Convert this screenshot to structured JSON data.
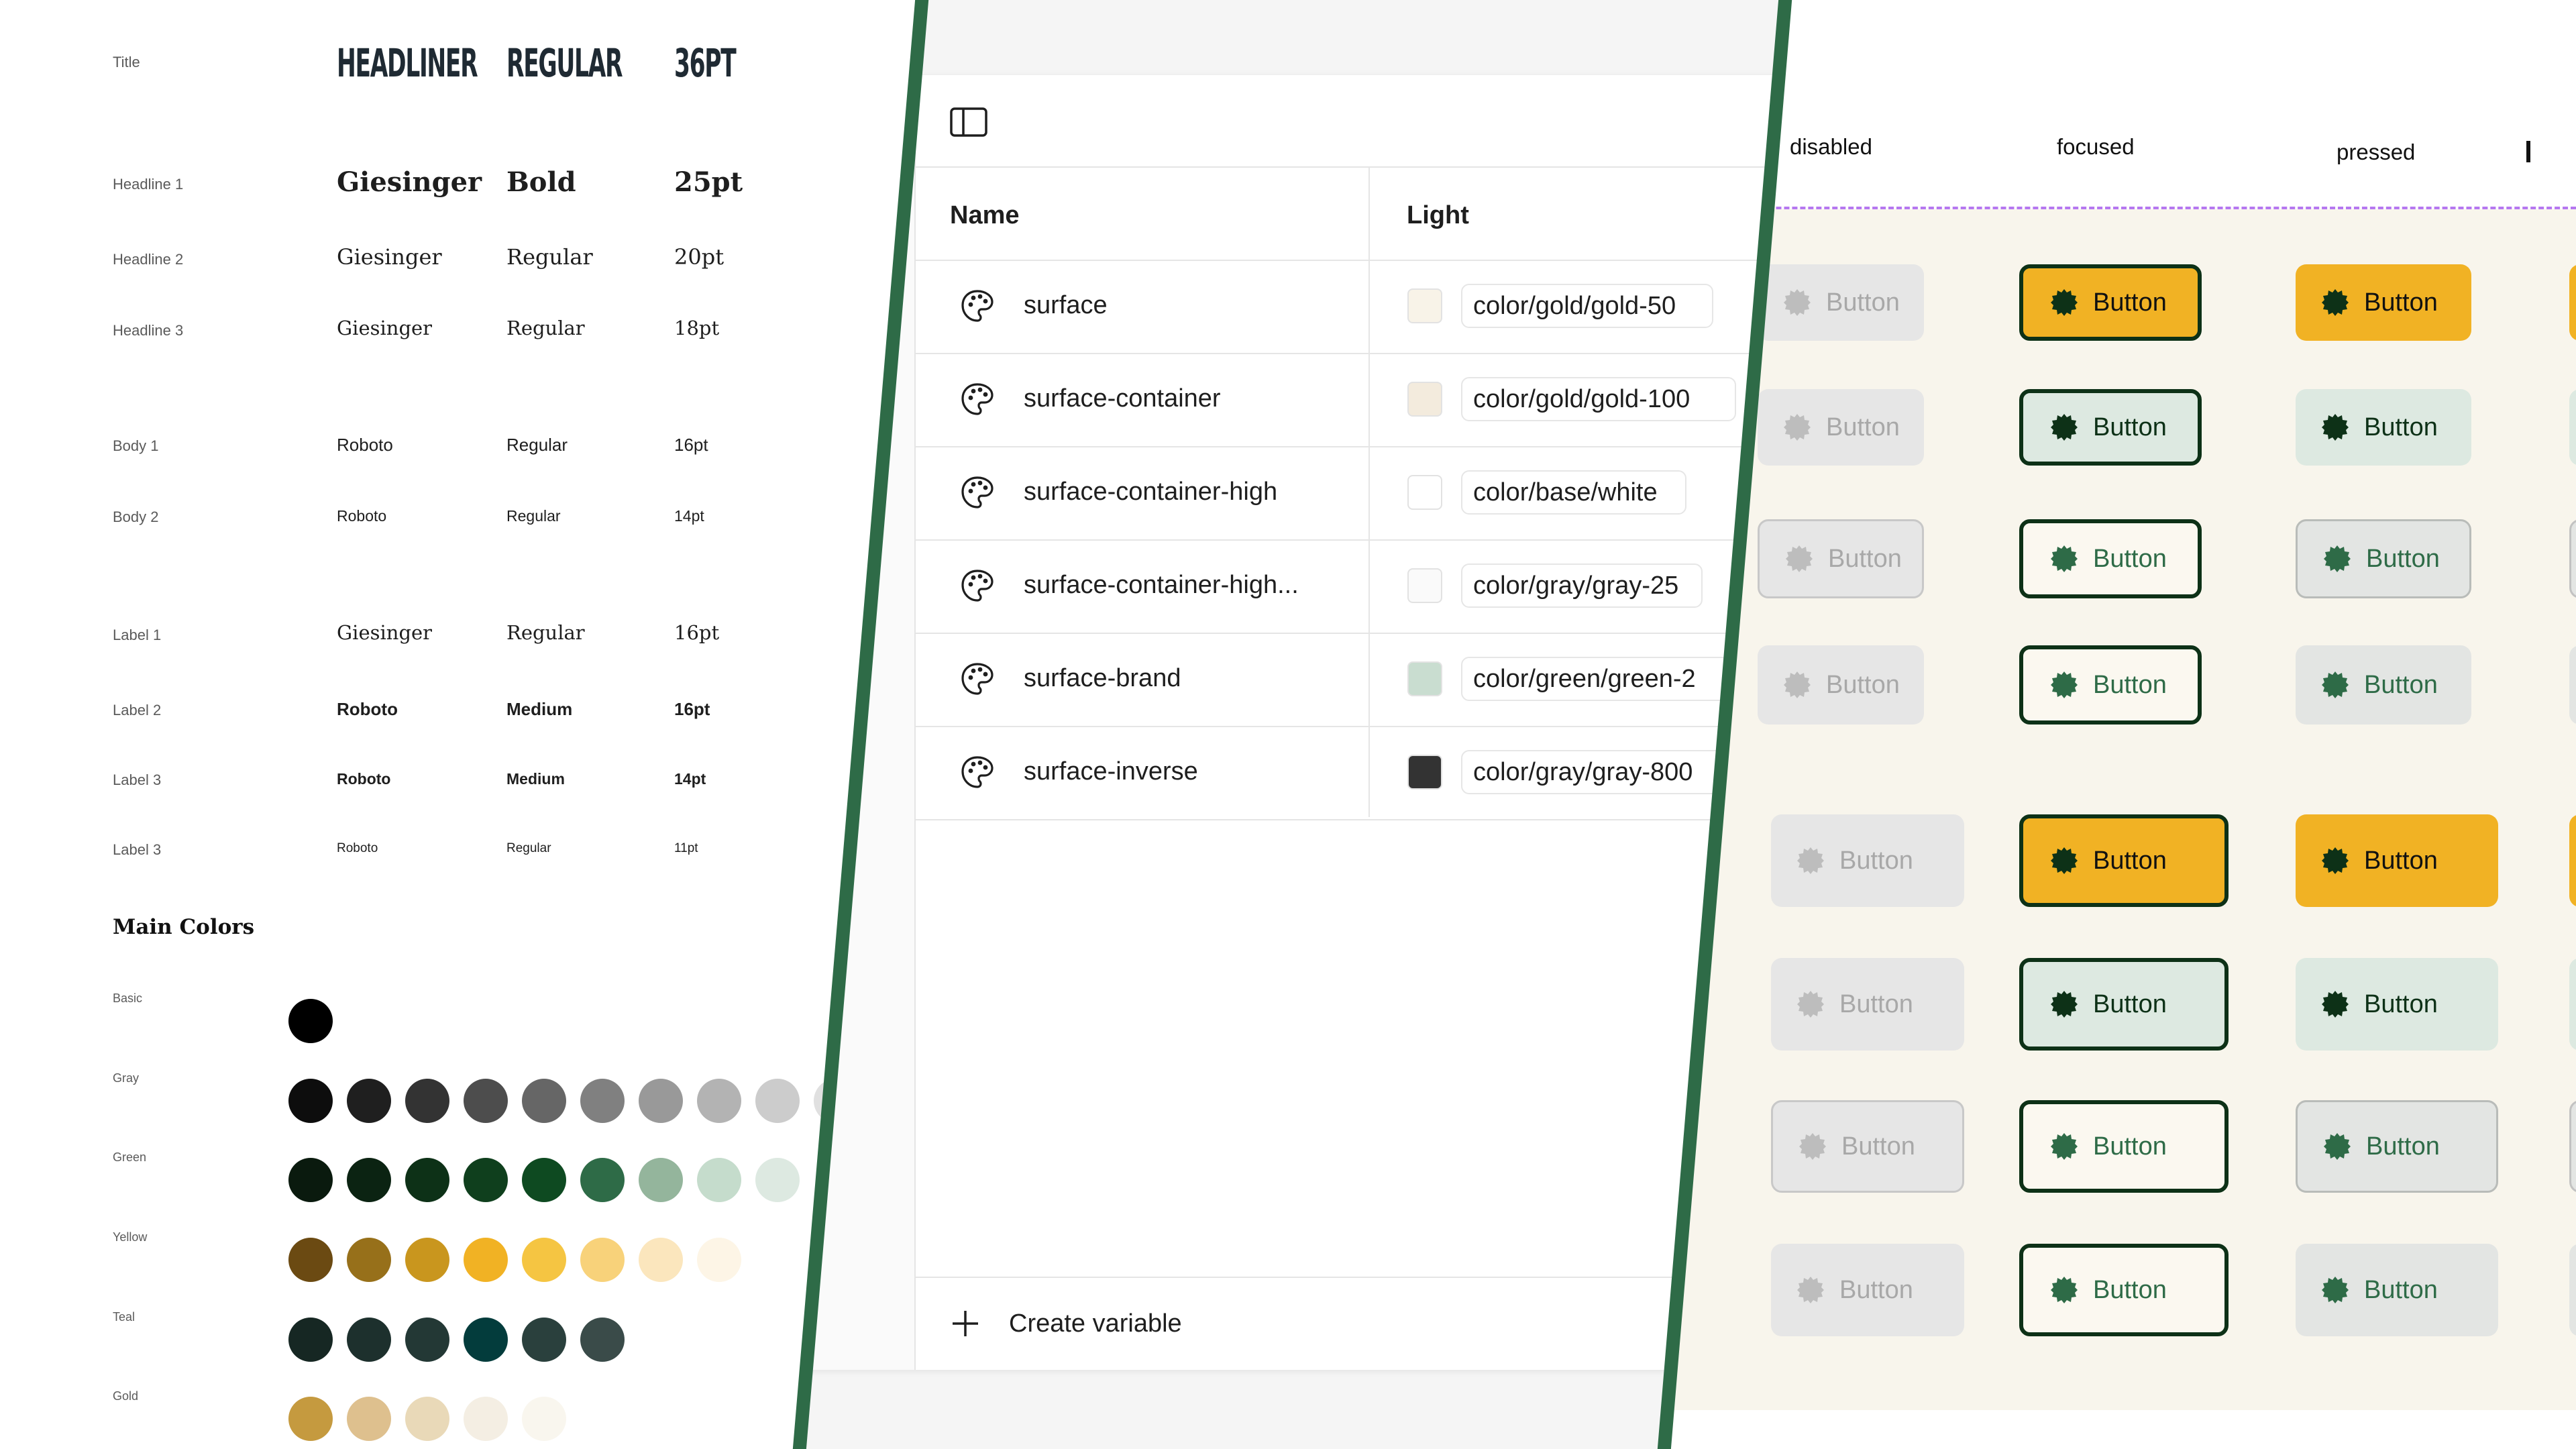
{
  "typography": {
    "rows": [
      {
        "label": "Title",
        "font": "HEADLINER",
        "weight": "REGULAR",
        "size": "36PT"
      },
      {
        "label": "Headline 1",
        "font": "Giesinger",
        "weight": "Bold",
        "size": "25pt"
      },
      {
        "label": "Headline 2",
        "font": "Giesinger",
        "weight": "Regular",
        "size": "20pt"
      },
      {
        "label": "Headline 3",
        "font": "Giesinger",
        "weight": "Regular",
        "size": "18pt"
      },
      {
        "label": "Body 1",
        "font": "Roboto",
        "weight": "Regular",
        "size": "16pt"
      },
      {
        "label": "Body 2",
        "font": "Roboto",
        "weight": "Regular",
        "size": "14pt"
      },
      {
        "label": "Label 1",
        "font": "Giesinger",
        "weight": "Regular",
        "size": "16pt"
      },
      {
        "label": "Label 2",
        "font": "Roboto",
        "weight": "Medium",
        "size": "16pt"
      },
      {
        "label": "Label 3",
        "font": "Roboto",
        "weight": "Medium",
        "size": "14pt"
      },
      {
        "label": "Label 3",
        "font": "Roboto",
        "weight": "Regular",
        "size": "11pt"
      }
    ]
  },
  "main_colors": {
    "heading": "Main Colors",
    "groups": [
      {
        "name": "Basic",
        "colors": [
          "#000000"
        ]
      },
      {
        "name": "Gray",
        "colors": [
          "#0d0d0d",
          "#1f1f1f",
          "#333333",
          "#4d4d4d",
          "#666666",
          "#808080",
          "#999999",
          "#b3b3b3",
          "#cccccc",
          "#e0e0e0"
        ]
      },
      {
        "name": "Green",
        "colors": [
          "#0a1a0e",
          "#0b2312",
          "#0d3117",
          "#0f3f1d",
          "#0e4a21",
          "#2e6b47",
          "#94b59c",
          "#c5dccc",
          "#dde9e1"
        ]
      },
      {
        "name": "Yellow",
        "colors": [
          "#6b4a12",
          "#97701a",
          "#c9961e",
          "#f1b224",
          "#f5c542",
          "#f8d27a",
          "#fbe6bd",
          "#fdf5e6"
        ]
      },
      {
        "name": "Teal",
        "colors": [
          "#162723",
          "#1d302d",
          "#233835",
          "#033c3c",
          "#2a403d",
          "#3a4b49"
        ]
      },
      {
        "name": "Gold",
        "colors": [
          "#c59a3f",
          "#dec08e",
          "#e9d9b8",
          "#f4eee3",
          "#f9f6ee"
        ]
      }
    ]
  },
  "variables": {
    "headers": {
      "name": "Name",
      "light": "Light"
    },
    "rows": [
      {
        "name": "surface",
        "value": "color/gold/gold-50",
        "swatch": "#f8f3e8"
      },
      {
        "name": "surface-container",
        "value": "color/gold/gold-100",
        "swatch": "#f3ebdd"
      },
      {
        "name": "surface-container-high",
        "value": "color/base/white",
        "swatch": "#ffffff"
      },
      {
        "name": "surface-container-high...",
        "value": "color/gray/gray-25",
        "swatch": "#fafafa"
      },
      {
        "name": "surface-brand",
        "value": "color/green/green-2",
        "swatch": "#c9ddd0"
      },
      {
        "name": "surface-inverse",
        "value": "color/gray/gray-800",
        "swatch": "#333333"
      }
    ],
    "create_label": "Create variable"
  },
  "buttons": {
    "columns": [
      "disabled",
      "focused",
      "pressed"
    ],
    "label": "Button",
    "colors": {
      "brand_green": "#0d3117",
      "accent_yellow": "#f1b224",
      "surface": "#f8f5ec"
    }
  }
}
